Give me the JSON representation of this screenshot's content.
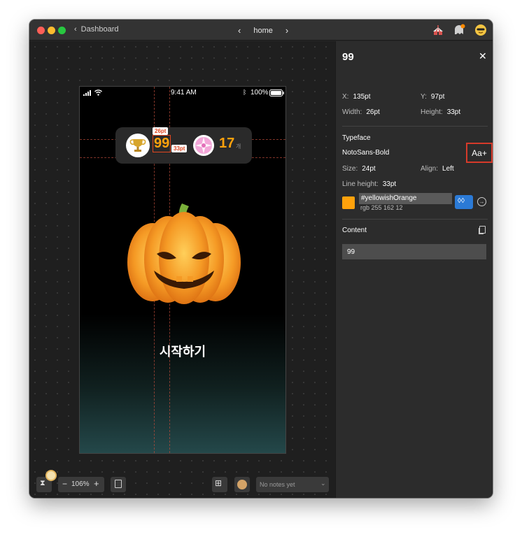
{
  "titlebar": {
    "back_label": "Dashboard",
    "page_title": "home"
  },
  "phone": {
    "status_time": "9:41 AM",
    "battery": "100%",
    "score": "99",
    "candy_count": "17",
    "candy_unit": "개",
    "measure_width": "26pt",
    "measure_height": "33pt",
    "start_label": "시작하기"
  },
  "bottombar": {
    "zoom": "106%",
    "notes_placeholder": "No notes yet"
  },
  "inspector": {
    "title": "99",
    "x_label": "X:",
    "x_value": "135pt",
    "y_label": "Y:",
    "y_value": "97pt",
    "width_label": "Width:",
    "width_value": "26pt",
    "height_label": "Height:",
    "height_value": "33pt",
    "typeface_heading": "Typeface",
    "font_name": "NotoSans-Bold",
    "aa_label": "Aa+",
    "size_label": "Size:",
    "size_value": "24pt",
    "align_label": "Align:",
    "align_value": "Left",
    "line_height_label": "Line height:",
    "line_height_value": "33pt",
    "color_name": "#yellowishOrange",
    "color_rgb": "rgb 255 162 12",
    "content_heading": "Content",
    "content_value": "99"
  },
  "colors": {
    "accent_orange": "#ffa20c",
    "measure_red": "#e0461f",
    "drop_blue": "#2b7ad6"
  }
}
